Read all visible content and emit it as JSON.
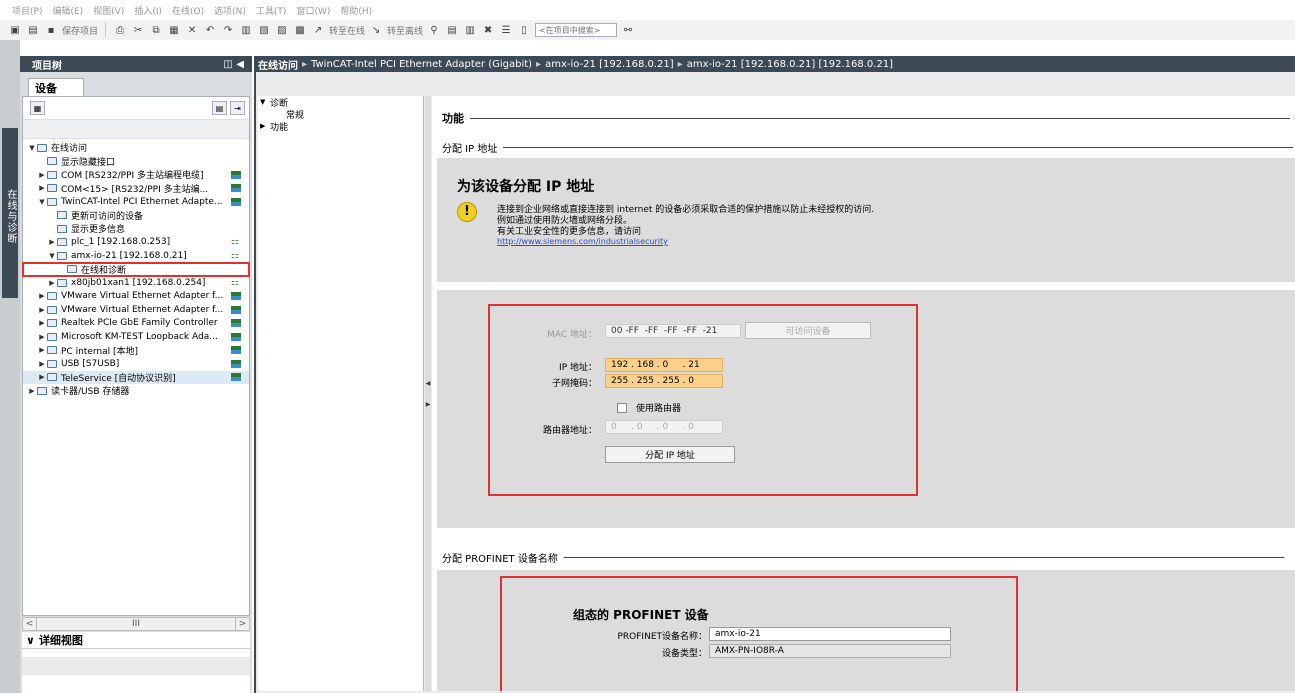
{
  "menu": [
    "项目(P)",
    "编辑(E)",
    "视图(V)",
    "插入(I)",
    "在线(O)",
    "选项(N)",
    "工具(T)",
    "窗口(W)",
    "帮助(H)"
  ],
  "toolbar": {
    "save_label": "保存项目",
    "go_online_label": "转至在线",
    "go_offline_label": "转至离线",
    "search_placeholder": "<在项目中搜索>"
  },
  "side_tab": "在线与诊断",
  "project_tree": {
    "title": "项目树",
    "tab": "设备",
    "items": [
      {
        "label": "在线访问",
        "arrow": "▼",
        "indent": 0,
        "icon": "online-access-icon"
      },
      {
        "label": "显示隐藏接口",
        "arrow": "",
        "indent": 1,
        "icon": "interface-icon"
      },
      {
        "label": "COM [RS232/PPI 多主站编程电缆]",
        "arrow": "▶",
        "indent": 1,
        "icon": "folder-icon",
        "badge": "net"
      },
      {
        "label": "COM<15> [RS232/PPI 多主站编...",
        "arrow": "▶",
        "indent": 1,
        "icon": "folder-icon",
        "badge": "net"
      },
      {
        "label": "TwinCAT-Intel PCI Ethernet Adapte...",
        "arrow": "▼",
        "indent": 1,
        "icon": "folder-icon",
        "badge": "net"
      },
      {
        "label": "更新可访问的设备",
        "arrow": "",
        "indent": 2,
        "icon": "update-icon"
      },
      {
        "label": "显示更多信息",
        "arrow": "",
        "indent": 2,
        "icon": "info-icon"
      },
      {
        "label": "plc_1 [192.168.0.253]",
        "arrow": "▶",
        "indent": 2,
        "icon": "device-icon",
        "badge": "plc"
      },
      {
        "label": "amx-io-21 [192.168.0.21]",
        "arrow": "▼",
        "indent": 2,
        "icon": "device-icon",
        "badge": "plc"
      },
      {
        "label": "在线和诊断",
        "arrow": "",
        "indent": 3,
        "icon": "diagnostics-icon",
        "highlight": true
      },
      {
        "label": "x80jb01xan1 [192.168.0.254]",
        "arrow": "▶",
        "indent": 2,
        "icon": "device-icon",
        "badge": "plc"
      },
      {
        "label": "VMware Virtual Ethernet Adapter f...",
        "arrow": "▶",
        "indent": 1,
        "icon": "folder-icon",
        "badge": "net"
      },
      {
        "label": "VMware Virtual Ethernet Adapter f...",
        "arrow": "▶",
        "indent": 1,
        "icon": "folder-icon",
        "badge": "net"
      },
      {
        "label": "Realtek PCIe GbE Family Controller",
        "arrow": "▶",
        "indent": 1,
        "icon": "folder-icon",
        "badge": "net"
      },
      {
        "label": "Microsoft KM-TEST Loopback Ada...",
        "arrow": "▶",
        "indent": 1,
        "icon": "folder-icon",
        "badge": "net"
      },
      {
        "label": "PC internal [本地]",
        "arrow": "▶",
        "indent": 1,
        "icon": "folder-icon",
        "badge": "net"
      },
      {
        "label": "USB [S7USB]",
        "arrow": "▶",
        "indent": 1,
        "icon": "folder-icon",
        "badge": "net"
      },
      {
        "label": "TeleService [自动协议识别]",
        "arrow": "▶",
        "indent": 1,
        "icon": "folder-icon",
        "badge": "net",
        "selected": true
      },
      {
        "label": "读卡器/USB 存储器",
        "arrow": "▶",
        "indent": 0,
        "icon": "card-reader-icon"
      }
    ],
    "scroll_mark": "III",
    "detail_title": "详细视图"
  },
  "breadcrumb": [
    "在线访问",
    "TwinCAT-Intel PCI Ethernet Adapter (Gigabit)",
    "amx-io-21 [192.168.0.21]",
    "amx-io-21 [192.168.0.21] [192.168.0.21]"
  ],
  "nav": [
    {
      "label": "诊断",
      "arrow": "▼",
      "indent": 0
    },
    {
      "label": "常规",
      "arrow": "",
      "indent": 1
    },
    {
      "label": "功能",
      "arrow": "▶",
      "indent": 0
    }
  ],
  "content": {
    "function_title": "功能",
    "assign_ip_section": "分配 IP 地址",
    "notice": {
      "title": "为该设备分配 IP 地址",
      "lines": [
        "连接到企业网络或直接连接到 internet 的设备必须采取合适的保护措施以防止未经授权的访问.",
        "例如通过使用防火墙或网络分段。",
        "有关工业安全性的更多信息，请访问"
      ],
      "link": "http://www.siemens.com/industrialsecurity"
    },
    "ip_form": {
      "mac_label": "MAC 地址：",
      "mac_value": "00 -FF  -FF  -FF  -FF  -21",
      "accessible_btn": "可访问设备",
      "ip_label": "IP 地址：",
      "ip_value": "192 . 168 . 0     . 21",
      "subnet_label": "子网掩码：",
      "subnet_value": "255 . 255 . 255 . 0",
      "router_checkbox": "使用路由器",
      "router_label": "路由器地址：",
      "router_value": "0     . 0     . 0     . 0",
      "assign_btn": "分配 IP 地址"
    },
    "profinet_section": "分配 PROFINET 设备名称",
    "profinet": {
      "title": "组态的 PROFINET 设备",
      "name_label": "PROFINET设备名称：",
      "name_value": "amx-io-21",
      "type_label": "设备类型：",
      "type_value": "AMX-PN-IO8R-A"
    }
  },
  "colors": {
    "header_bg": "#3c4a56",
    "highlight_red": "#e03030",
    "field_orange": "#fbd08a",
    "panel_gray": "#dcdcdc"
  }
}
